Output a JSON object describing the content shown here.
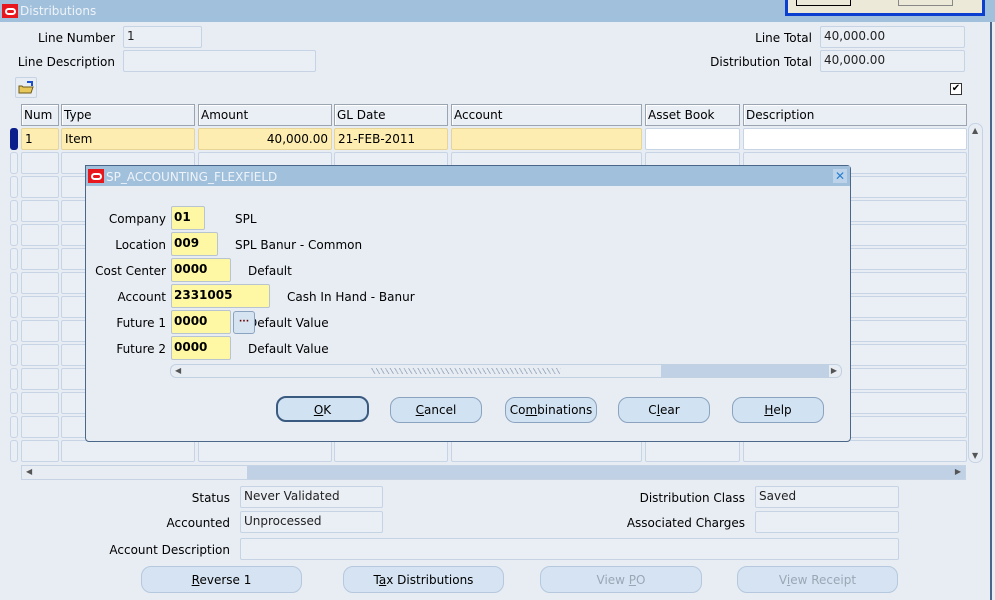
{
  "window": {
    "title": "Distributions"
  },
  "header": {
    "line_number_label": "Line Number",
    "line_number": "1",
    "line_description_label": "Line Description",
    "line_description": "",
    "line_total_label": "Line Total",
    "line_total": "40,000.00",
    "distribution_total_label": "Distribution Total",
    "distribution_total": "40,000.00",
    "checkbox_checked": true
  },
  "table": {
    "columns": [
      "Num",
      "Type",
      "Amount",
      "GL Date",
      "Account",
      "Asset Book",
      "Description"
    ],
    "rows": [
      {
        "num": "1",
        "type": "Item",
        "amount": "40,000.00",
        "gl_date": "21-FEB-2011",
        "account": "",
        "asset_book": "",
        "description": ""
      }
    ]
  },
  "dialog": {
    "title": "SP_ACCOUNTING_FLEXFIELD",
    "segments": [
      {
        "label": "Company",
        "value": "01",
        "description": "SPL"
      },
      {
        "label": "Location",
        "value": "009",
        "description": "SPL Banur - Common"
      },
      {
        "label": "Cost Center",
        "value": "0000",
        "description": "Default"
      },
      {
        "label": "Account",
        "value": "2331005",
        "description": "Cash In Hand - Banur"
      },
      {
        "label": "Future 1",
        "value": "0000",
        "description": "Default Value"
      },
      {
        "label": "Future 2",
        "value": "0000",
        "description": "Default Value"
      }
    ],
    "buttons": {
      "ok": {
        "pre": "",
        "mn": "O",
        "post": "K"
      },
      "cancel": {
        "pre": "",
        "mn": "C",
        "post": "ancel"
      },
      "combinations": {
        "pre": "Co",
        "mn": "m",
        "post": "binations"
      },
      "clear": {
        "pre": "C",
        "mn": "l",
        "post": "ear"
      },
      "help": {
        "pre": "",
        "mn": "H",
        "post": "elp"
      }
    }
  },
  "footer": {
    "status_label": "Status",
    "status": "Never Validated",
    "accounted_label": "Accounted",
    "accounted": "Unprocessed",
    "account_description_label": "Account Description",
    "account_description": "",
    "distribution_class_label": "Distribution Class",
    "distribution_class": "Saved",
    "associated_charges_label": "Associated Charges",
    "associated_charges": "",
    "buttons": {
      "reverse": {
        "pre": "",
        "mn": "R",
        "post": "everse 1"
      },
      "tax": {
        "pre": "T",
        "mn": "a",
        "post": "x Distributions"
      },
      "view_po": {
        "pre": "View ",
        "mn": "P",
        "post": "O"
      },
      "view_receipt": {
        "pre": "V",
        "mn": "i",
        "post": "ew Receipt"
      }
    }
  }
}
